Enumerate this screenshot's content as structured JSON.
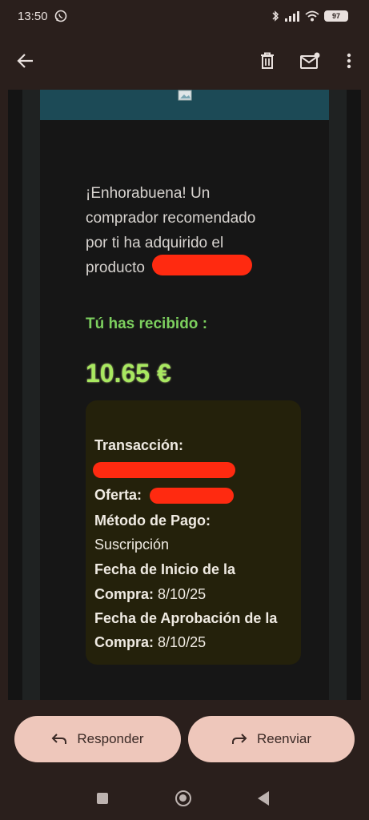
{
  "status_bar": {
    "time": "13:50",
    "battery": "97"
  },
  "email": {
    "congrats_line1": "¡Enhorabuena! Un",
    "congrats_line2": "comprador recomendado",
    "congrats_line3": "por ti ha adquirido el",
    "congrats_line4": "producto",
    "received_label": "Tú has recibido :",
    "amount": "10.65 €",
    "transaction": {
      "label": "Transacción:",
      "offer_label": "Oferta:",
      "payment_label": "Método de Pago:",
      "payment_value": "Suscripción",
      "start_label_line1": "Fecha de Inicio de la",
      "start_label_line2": "Compra:",
      "start_value": "8/10/25",
      "approval_label_line1": "Fecha de Aprobación de la",
      "approval_label_line2": "Compra:",
      "approval_value": "8/10/25"
    }
  },
  "actions": {
    "reply_label": "Responder",
    "forward_label": "Reenviar"
  },
  "colors": {
    "background": "#2a1f1c",
    "green_text": "#7ccf5e",
    "amount_green": "#a8e860",
    "button_bg": "#eec7bb",
    "redaction": "#ff2a10"
  }
}
